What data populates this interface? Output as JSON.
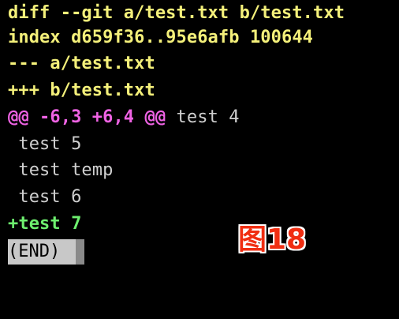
{
  "diff": {
    "header_diff": "diff --git a/test.txt b/test.txt",
    "header_index": "index d659f36..95e6afb 100644",
    "header_old": "--- a/test.txt",
    "header_new": "+++ b/test.txt",
    "hunk_header": "@@ -6,3 +6,4 @@",
    "hunk_context": " test 4",
    "context_lines": [
      " test 5",
      " test temp",
      " test 6"
    ],
    "added_line": "+test 7"
  },
  "pager": {
    "end_marker": "(END)"
  },
  "annotation": {
    "label": "图18"
  },
  "colors": {
    "background": "#000000",
    "header": "#f4f07a",
    "hunk": "#ef63e4",
    "context": "#cfcfcf",
    "added": "#6ef06f",
    "annotation": "#f02e12"
  }
}
